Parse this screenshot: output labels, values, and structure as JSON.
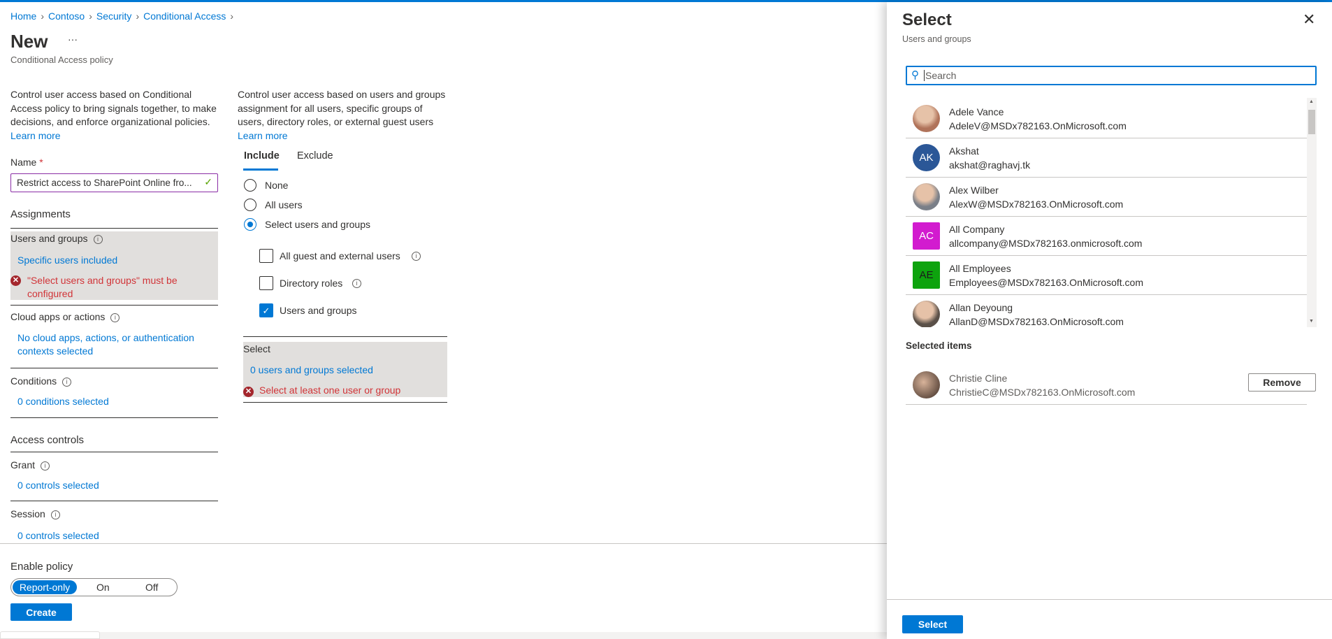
{
  "breadcrumb": [
    "Home",
    "Contoso",
    "Security",
    "Conditional Access"
  ],
  "page": {
    "title": "New",
    "more": "···",
    "subtitle": "Conditional Access policy"
  },
  "left": {
    "description": "Control user access based on Conditional Access policy to bring signals together, to make decisions, and enforce organizational policies.",
    "learn_more": "Learn more",
    "name_label": "Name",
    "required": "*",
    "name_value": "Restrict access to SharePoint Online fro...",
    "assignments": "Assignments",
    "users_groups": {
      "label": "Users and groups",
      "value": "Specific users included",
      "error": "\"Select users and groups\" must be configured"
    },
    "cloud_apps": {
      "label": "Cloud apps or actions",
      "value": "No cloud apps, actions, or authentication contexts selected"
    },
    "conditions": {
      "label": "Conditions",
      "value": "0 conditions selected"
    },
    "access_controls": "Access controls",
    "grant": {
      "label": "Grant",
      "value": "0 controls selected"
    },
    "session": {
      "label": "Session",
      "value": "0 controls selected"
    }
  },
  "middle": {
    "description": "Control user access based on users and groups assignment for all users, specific groups of users, directory roles, or external guest users",
    "learn_more": "Learn more",
    "tabs": [
      "Include",
      "Exclude"
    ],
    "radios": [
      {
        "label": "None",
        "checked": false
      },
      {
        "label": "All users",
        "checked": false
      },
      {
        "label": "Select users and groups",
        "checked": true
      }
    ],
    "checkboxes": [
      {
        "label": "All guest and external users",
        "checked": false
      },
      {
        "label": "Directory roles",
        "checked": false
      },
      {
        "label": "Users and groups",
        "checked": true
      }
    ],
    "select": {
      "label": "Select",
      "value": "0 users and groups selected",
      "error": "Select at least one user or group"
    }
  },
  "footer": {
    "enable_policy": "Enable policy",
    "toggle": [
      "Report-only",
      "On",
      "Off"
    ],
    "selected_toggle": "Report-only",
    "create": "Create"
  },
  "panel": {
    "title": "Select",
    "subtitle": "Users and groups",
    "search_placeholder": "Search",
    "items": [
      {
        "name": "Adele Vance",
        "email": "AdeleV@MSDx782163.OnMicrosoft.com",
        "avatar": "photo",
        "color": "#b0735a"
      },
      {
        "name": "Akshat",
        "email": "akshat@raghavj.tk",
        "avatar": "AK",
        "color": "#2b5797"
      },
      {
        "name": "Alex Wilber",
        "email": "AlexW@MSDx782163.OnMicrosoft.com",
        "avatar": "photo",
        "color": "#7a7f88"
      },
      {
        "name": "All Company",
        "email": "allcompany@MSDx782163.onmicrosoft.com",
        "avatar": "AC",
        "color": "#d21bcf"
      },
      {
        "name": "All Employees",
        "email": "Employees@MSDx782163.OnMicrosoft.com",
        "avatar": "AE",
        "color": "#0ea30e"
      },
      {
        "name": "Allan Deyoung",
        "email": "AllanD@MSDx782163.OnMicrosoft.com",
        "avatar": "photo",
        "color": "#5a5048"
      }
    ],
    "selected_heading": "Selected items",
    "selected": {
      "name": "Christie Cline",
      "email": "ChristieC@MSDx782163.OnMicrosoft.com",
      "remove": "Remove"
    },
    "select_button": "Select"
  }
}
